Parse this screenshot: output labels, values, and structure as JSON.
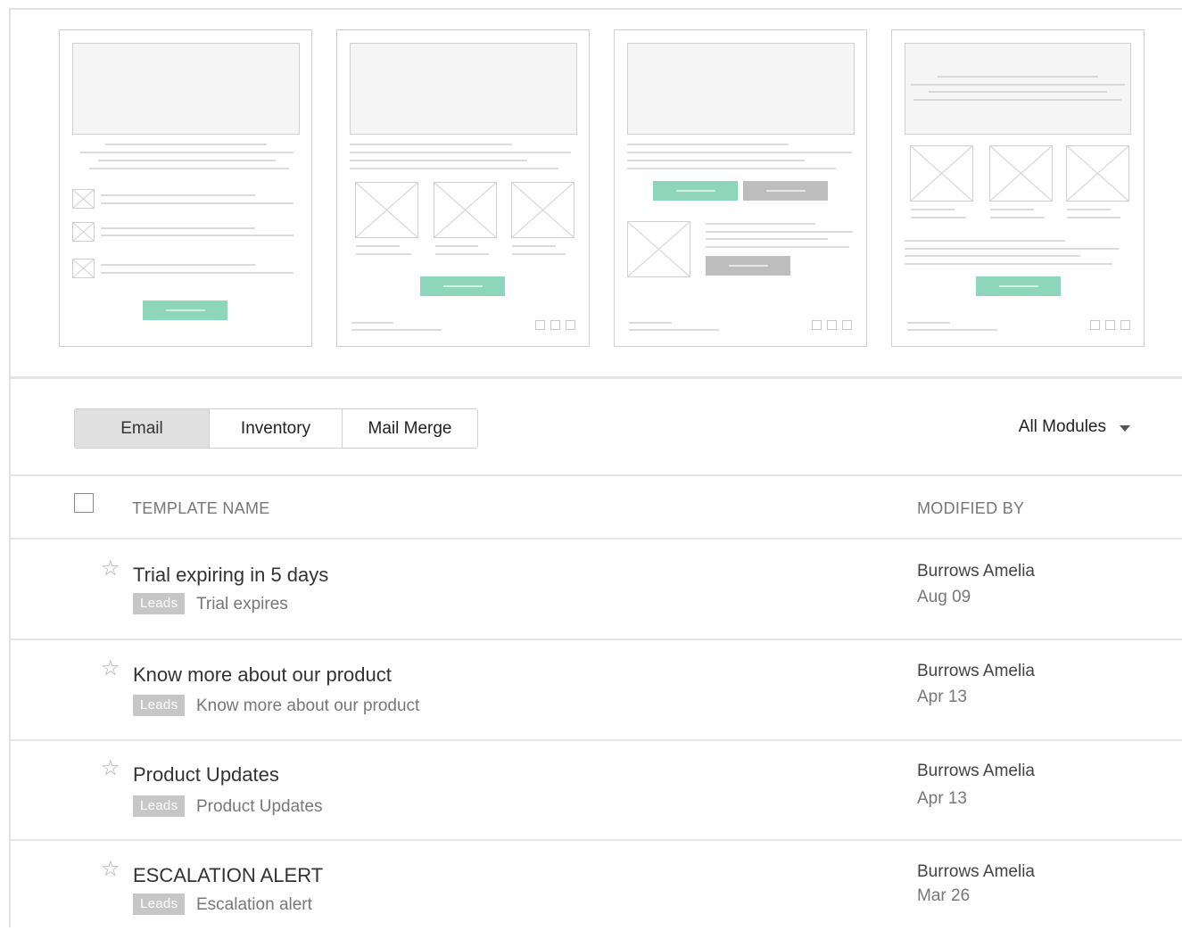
{
  "tabs": {
    "email": "Email",
    "inventory": "Inventory",
    "mail_merge": "Mail Merge",
    "active": "Email"
  },
  "filter": {
    "module_label": "All Modules",
    "icon": "caret-down-icon"
  },
  "table": {
    "headers": {
      "name": "TEMPLATE NAME",
      "modified_by": "MODIFIED BY"
    },
    "rows": [
      {
        "title": "Trial expiring in 5 days",
        "module": "Leads",
        "subject": "Trial expires",
        "modified_by": "Burrows Amelia",
        "date": "Aug 09",
        "starred": false
      },
      {
        "title": "Know more about our product",
        "module": "Leads",
        "subject": "Know more about our product",
        "modified_by": "Burrows Amelia",
        "date": "Apr 13",
        "starred": false
      },
      {
        "title": "Product Updates",
        "module": "Leads",
        "subject": "Product Updates",
        "modified_by": "Burrows Amelia",
        "date": "Apr 13",
        "starred": false
      },
      {
        "title": "ESCALATION ALERT",
        "module": "Leads",
        "subject": "Escalation alert",
        "modified_by": "Burrows Amelia",
        "date": "Mar 26",
        "starred": false
      }
    ]
  },
  "colors": {
    "accent_button": "#8dd5bb",
    "secondary_button": "#bdbdbd",
    "badge": "#c6c6c6",
    "active_tab": "#e0e0e0"
  },
  "icons": {
    "star": "star-outline-icon",
    "checkbox": "checkbox-icon",
    "image_placeholder": "image-placeholder-icon"
  }
}
